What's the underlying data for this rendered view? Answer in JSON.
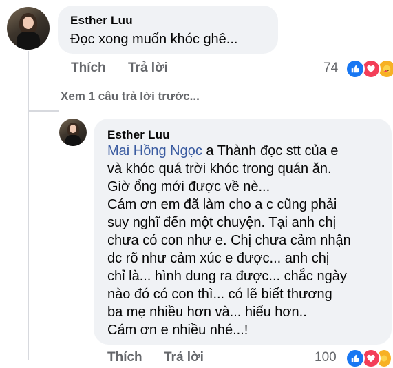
{
  "comment": {
    "author": "Esther Luu",
    "text": "Đọc xong muốn khóc ghê...",
    "actions": {
      "like": "Thích",
      "reply": "Trả lời"
    },
    "reaction_count": "74"
  },
  "view_previous": "Xem 1 câu trả lời trước...",
  "reply": {
    "author": "Esther Luu",
    "mention": "Mai Hồng Ngọc",
    "lines": [
      " a Thành đọc stt của e",
      "và khóc quá trời khóc trong quán ăn.",
      "Giờ ổng mới được về nè...",
      "Cám ơn em đã làm cho a c cũng phải",
      "suy nghĩ đến một chuyện. Tại anh chị",
      "chưa có con như e. Chị chưa cảm nhận",
      "dc rõ như cảm xúc e được... anh chị",
      "chỉ là... hình dung ra được... chắc ngày",
      "nào đó có con thì... có lẽ biết thương",
      "ba mẹ nhiều hơn và... hiểu hơn..",
      "Cám ơn e nhiều nhé...!"
    ],
    "actions": {
      "like": "Thích",
      "reply": "Trả lời"
    },
    "reaction_count": "100"
  },
  "colors": {
    "like": "#1877f2",
    "love": "#f33e58",
    "care": "#f7b125",
    "mention": "#3a5ba0"
  }
}
